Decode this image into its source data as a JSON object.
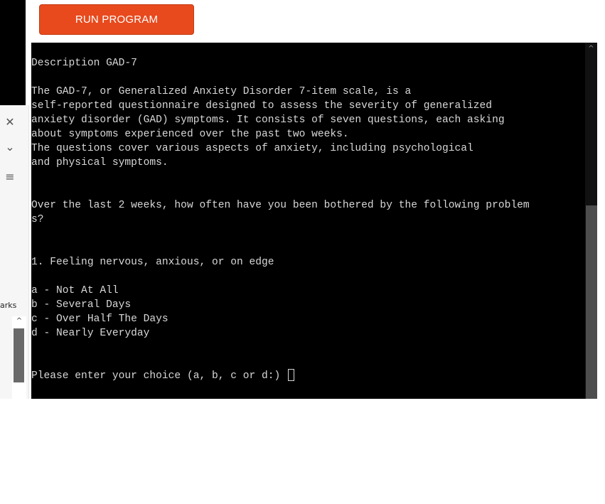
{
  "toolbar": {
    "run_label": "RUN PROGRAM"
  },
  "side_panel": {
    "label_fragment": "arks",
    "icons": [
      "close-icon",
      "chevron-down-icon",
      "menu-icon",
      "chevron-up-icon"
    ]
  },
  "terminal": {
    "lines": [
      "Description GAD-7",
      "",
      "The GAD-7, or Generalized Anxiety Disorder 7-item scale, is a",
      "self-reported questionnaire designed to assess the severity of generalized",
      "anxiety disorder (GAD) symptoms. It consists of seven questions, each asking",
      "about symptoms experienced over the past two weeks.",
      "The questions cover various aspects of anxiety, including psychological",
      "and physical symptoms.",
      "",
      "",
      "Over the last 2 weeks, how often have you been bothered by the following problem",
      "s?",
      "",
      "",
      "1. Feeling nervous, anxious, or on edge",
      "",
      "a - Not At All",
      "b - Several Days",
      "c - Over Half The Days",
      "d - Nearly Everyday",
      "",
      "",
      "Please enter your choice (a, b, c or d:) "
    ]
  },
  "colors": {
    "run_button": "#e84a1d",
    "terminal_bg": "#000000",
    "terminal_text": "#d8d8d8"
  }
}
